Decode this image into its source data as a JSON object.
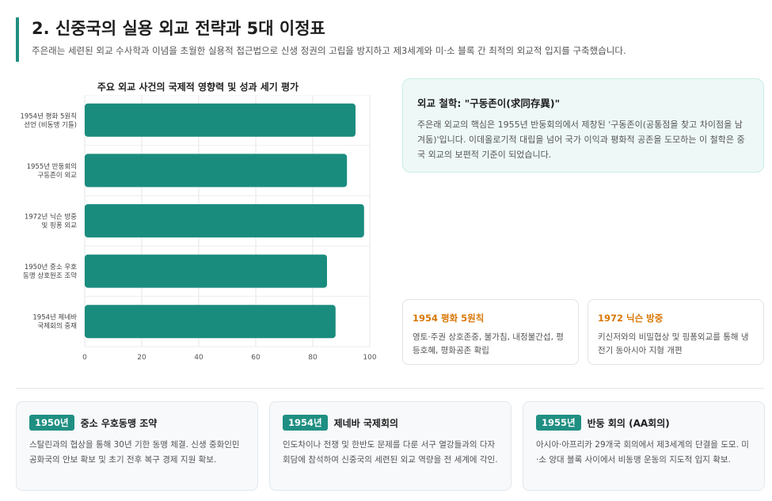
{
  "header": {
    "title": "2. 신중국의 실용 외교 전략과 5대 이정표",
    "subtitle": "주은래는 세련된 외교 수사학과 이념을 초월한 실용적 접근법으로 신생 정권의 고립을 방지하고 제3세계와 미·소 블록 간 최적의 외교적 입지를 구축했습니다."
  },
  "chart_data": {
    "type": "bar",
    "orientation": "horizontal",
    "title": "주요 외교 사건의 국제적 영향력 및 성과 세기 평가",
    "categories": [
      [
        "1954년 평화 5원칙",
        "선언 (비동맹 기틀)"
      ],
      [
        "1955년 반둥회의",
        "구동존이 외교"
      ],
      [
        "1972년 닉슨 방중",
        "및 핑퐁 외교"
      ],
      [
        "1950년 중소 우호",
        "동맹 상호원조 조약"
      ],
      [
        "1954년 제네바",
        "국제회의 중재"
      ]
    ],
    "values": [
      95,
      92,
      98,
      85,
      88
    ],
    "xlim": [
      0,
      100
    ],
    "xticks": [
      0,
      20,
      40,
      60,
      80,
      100
    ],
    "grid": true,
    "bar_color": "#1a8c7e"
  },
  "philosophy": {
    "title": "외교 철학: \"구동존이(求同存異)\"",
    "body": "주은래 외교의 핵심은 1955년 반둥회의에서 제창된 '구동존이(공통점을 찾고 차이점을 남겨둠)'입니다. 이데올로기적 대립을 넘어 국가 이익과 평화적 공존을 도모하는 이 철학은 중국 외교의 보편적 기준이 되었습니다."
  },
  "mini_cards": [
    {
      "title": "1954 평화 5원칙",
      "body": "영토·주권 상호존중, 불가침, 내정불간섭, 평등호혜, 평화공존 확립"
    },
    {
      "title": "1972 닉슨 방중",
      "body": "키신저와의 비밀협상 및 핑퐁외교를 통해 냉전기 동아시아 지형 개편"
    }
  ],
  "timeline": [
    {
      "year": "1950년",
      "title": "중소 우호동맹 조약",
      "body": "스탈린과의 협상을 통해 30년 기한 동맹 체결. 신생 중화인민공화국의 안보 확보 및 초기 전후 복구 경제 지원 확보."
    },
    {
      "year": "1954년",
      "title": "제네바 국제회의",
      "body": "인도차이나 전쟁 및 한반도 문제를 다룬 서구 열강들과의 다자회담에 참석하여 신중국의 세련된 외교 역량을 전 세계에 각인."
    },
    {
      "year": "1955년",
      "title": "반둥 회의 (AA회의)",
      "body": "아시아·아프리카 29개국 회의에서 제3세계의 단결을 도모. 미·소 양대 블록 사이에서 비동맹 운동의 지도적 입지 확보."
    }
  ]
}
